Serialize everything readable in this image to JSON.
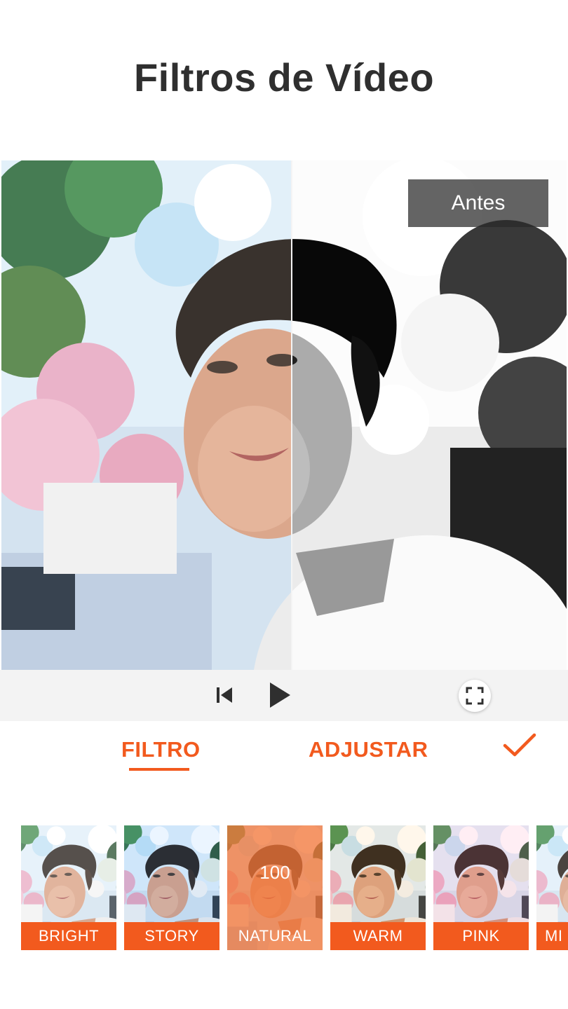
{
  "title": "Filtros de Vídeo",
  "preview": {
    "compare_label": "Antes"
  },
  "playback": {
    "skip_back_icon": "skip-previous-icon",
    "play_icon": "play-icon",
    "fullscreen_icon": "fullscreen-icon"
  },
  "tabs": {
    "filter": "FILTRO",
    "adjust": "ADJUSTAR",
    "active": "FILTRO",
    "confirm_icon": "checkmark-icon"
  },
  "filters": [
    {
      "name": "BRIGHT",
      "selected": false
    },
    {
      "name": "STORY",
      "selected": false
    },
    {
      "name": "NATURAL",
      "selected": true,
      "intensity": "100"
    },
    {
      "name": "WARM",
      "selected": false
    },
    {
      "name": "PINK",
      "selected": false
    },
    {
      "name": "MI",
      "selected": false
    }
  ],
  "colors": {
    "accent": "#f25a1e",
    "title": "#2f2f2f",
    "controls_bg": "#f3f3f3"
  }
}
